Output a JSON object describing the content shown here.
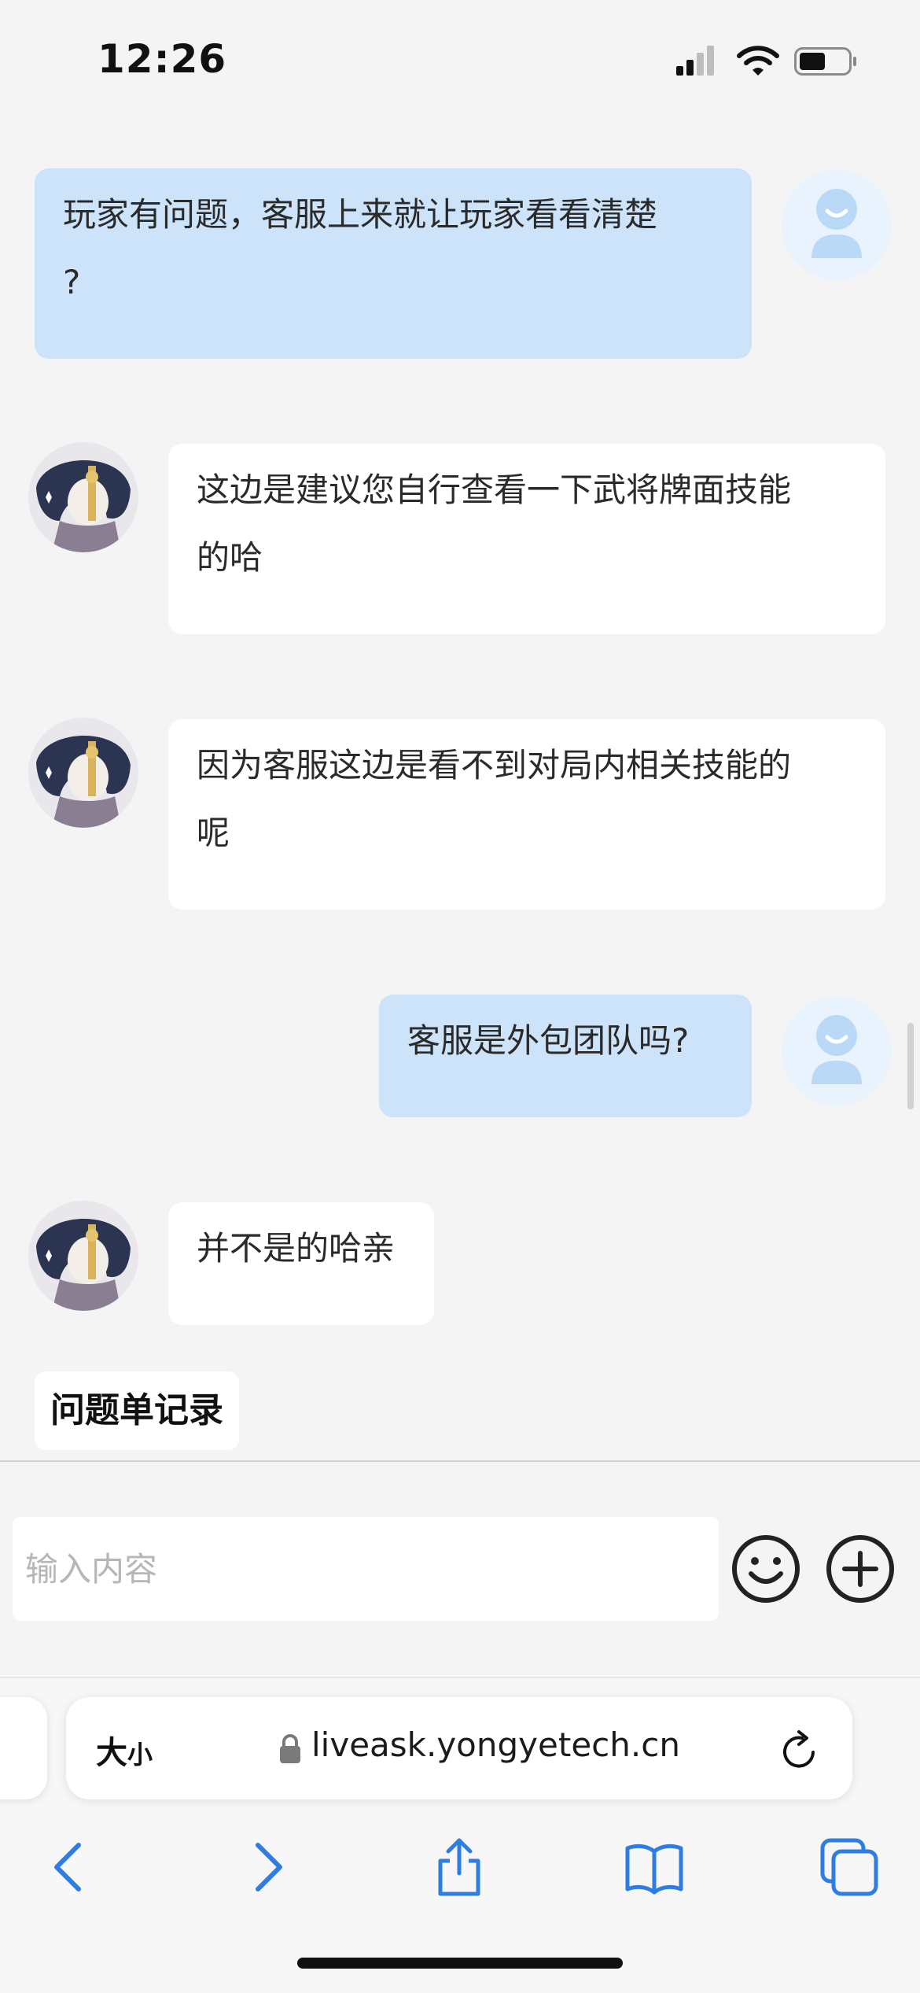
{
  "status_bar": {
    "time": "12:26"
  },
  "chat": {
    "messages": [
      {
        "from": "user",
        "lines": [
          "玩家有问题，客服上来就让玩家看看清楚",
          "?"
        ]
      },
      {
        "from": "agent",
        "lines": [
          "这边是建议您自行查看一下武将牌面技能",
          "的哈"
        ]
      },
      {
        "from": "agent",
        "lines": [
          "因为客服这边是看不到对局内相关技能的",
          "呢"
        ]
      },
      {
        "from": "user",
        "lines": [
          "客服是外包团队吗?"
        ]
      },
      {
        "from": "agent",
        "lines": [
          "并不是的哈亲"
        ]
      }
    ],
    "ticket_chip_label": "问题单记录"
  },
  "input_bar": {
    "placeholder": "输入内容",
    "emoji_icon": "smiley-icon",
    "add_icon": "plus-circle-icon"
  },
  "browser": {
    "text_size_label_big": "大",
    "text_size_label_small": "小",
    "url": "liveask.yongyetech.cn",
    "toolbar_icons": [
      "back-icon",
      "forward-icon",
      "share-icon",
      "bookmarks-icon",
      "tabs-icon"
    ]
  },
  "colors": {
    "user_bubble": "#cde3f9",
    "agent_bubble": "#ffffff",
    "background": "#f4f4f4",
    "accent": "#2f7de1"
  }
}
